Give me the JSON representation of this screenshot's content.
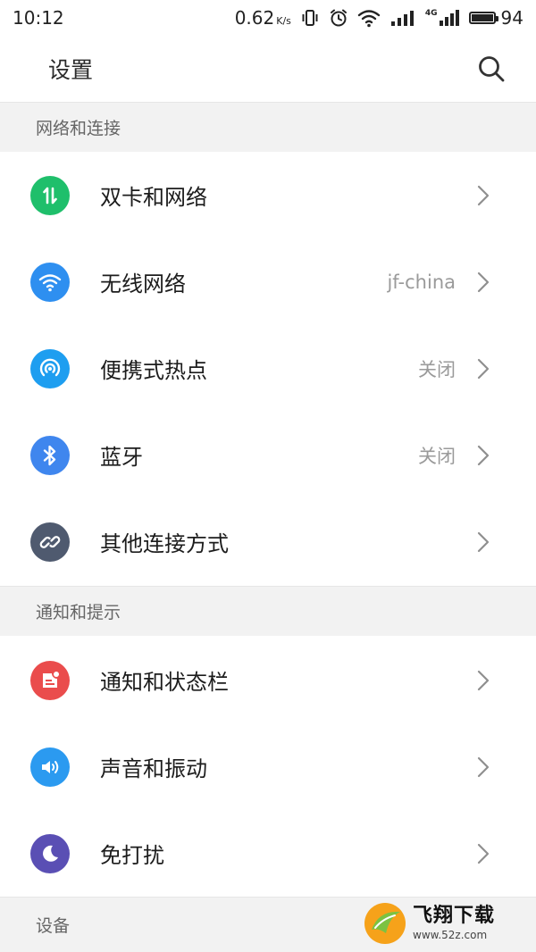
{
  "status_bar": {
    "time": "10:12",
    "speed": "0.62",
    "speed_unit": "K/s",
    "net_type": "4G",
    "battery": "94",
    "battery_level": 0.94
  },
  "header": {
    "title": "设置"
  },
  "sections": [
    {
      "title": "网络和连接",
      "items": [
        {
          "label": "双卡和网络",
          "value": "",
          "icon": "dual-sim-icon",
          "color": "#1fbf6b"
        },
        {
          "label": "无线网络",
          "value": "jf-china",
          "icon": "wifi-icon",
          "color": "#2e8ff0"
        },
        {
          "label": "便携式热点",
          "value": "关闭",
          "icon": "hotspot-icon",
          "color": "#1e9ef0"
        },
        {
          "label": "蓝牙",
          "value": "关闭",
          "icon": "bluetooth-icon",
          "color": "#3f86ee"
        },
        {
          "label": "其他连接方式",
          "value": "",
          "icon": "link-icon",
          "color": "#4f5a6f"
        }
      ]
    },
    {
      "title": "通知和提示",
      "items": [
        {
          "label": "通知和状态栏",
          "value": "",
          "icon": "notification-icon",
          "color": "#ea4c4c"
        },
        {
          "label": "声音和振动",
          "value": "",
          "icon": "sound-icon",
          "color": "#2b9af0"
        },
        {
          "label": "免打扰",
          "value": "",
          "icon": "moon-icon",
          "color": "#5a4fb4"
        }
      ]
    },
    {
      "title": "设备",
      "items": []
    }
  ],
  "watermark": {
    "title": "飞翔下载",
    "url": "www.52z.com"
  }
}
